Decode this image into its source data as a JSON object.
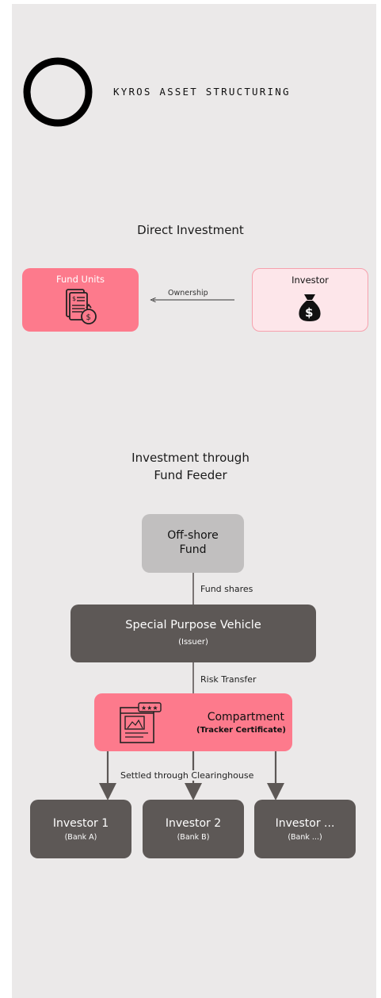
{
  "brand": {
    "name": "KYROS ASSET STRUCTURING"
  },
  "direct": {
    "heading": "Direct Investment",
    "fund_units": {
      "label": "Fund Units",
      "icon": "document-money-icon"
    },
    "investor": {
      "label": "Investor",
      "icon": "money-bag-icon"
    },
    "edge_label": "Ownership"
  },
  "feeder": {
    "heading_line1": "Investment through",
    "heading_line2": "Fund Feeder",
    "offshore": {
      "line1": "Off-shore",
      "line2": "Fund"
    },
    "edge1": "Fund shares",
    "spv": {
      "title": "Special Purpose Vehicle",
      "subtitle": "(Issuer)"
    },
    "edge2": "Risk Transfer",
    "compartment": {
      "title": "Compartment",
      "subtitle": "(Tracker Certificate)",
      "icon": "certificate-icon"
    },
    "edge3": "Settled through Clearinghouse",
    "investors": [
      {
        "title": "Investor 1",
        "subtitle": "(Bank A)"
      },
      {
        "title": "Investor 2",
        "subtitle": "(Bank B)"
      },
      {
        "title": "Investor ...",
        "subtitle": "(Bank ...)"
      }
    ]
  },
  "colors": {
    "pink": "#fd7a8c",
    "pink_light": "#fde6ea",
    "dark": "#5d5856",
    "grey": "#c1bfbf",
    "canvas": "#ebe9e9"
  }
}
